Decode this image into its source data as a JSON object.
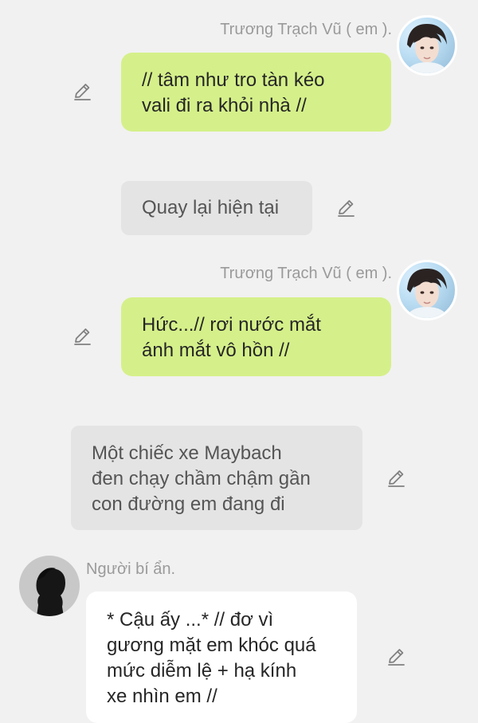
{
  "messages": [
    {
      "sender": "Trương Trạch Vũ ( em ).",
      "text": "// tâm như tro tàn kéo\nvali đi ra khỏi nhà //"
    },
    {
      "text": "Quay lại hiện tại"
    },
    {
      "sender": "Trương Trạch Vũ ( em ).",
      "text": "Hức...// rơi nước mắt\nánh mắt vô hồn //"
    },
    {
      "text": "Một chiếc xe Maybach\nđen chạy chầm chậm gần\ncon đường em đang đi"
    },
    {
      "sender": "Người bí ẩn.",
      "text": "* Cậu ấy ...* // đơ vì\ngương mặt em khóc quá\nmức diễm lệ + hạ kính\nxe nhìn em //"
    }
  ],
  "icons": {
    "edit": "pencil-edit-icon",
    "avatar_user": "boy-portrait-avatar",
    "avatar_mystery": "silhouette-avatar"
  },
  "colors": {
    "background": "#f1f1f1",
    "bubble_self": "#d5f08a",
    "bubble_narration": "#e4e4e4",
    "bubble_other": "#ffffff",
    "name_text": "#9a9a9a"
  }
}
